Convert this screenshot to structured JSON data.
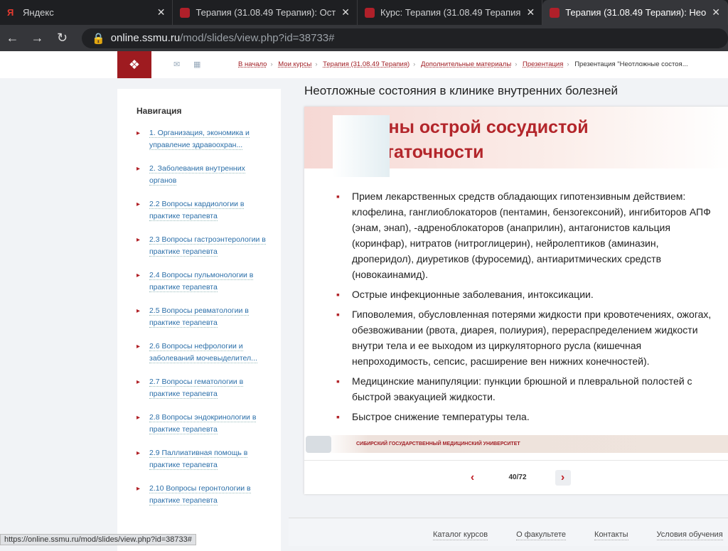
{
  "browser": {
    "tabs": [
      {
        "label": "Яндекс"
      },
      {
        "label": "Терапия (31.08.49 Терапия): Ост"
      },
      {
        "label": "Курс: Терапия (31.08.49 Терапия"
      },
      {
        "label": "Терапия (31.08.49 Терапия): Нео"
      }
    ],
    "url_host": "online.ssmu.ru",
    "url_path": "/mod/slides/view.php?id=38733#",
    "status_url": "https://online.ssmu.ru/mod/slides/view.php?id=38733#"
  },
  "breadcrumb": [
    "В начало",
    "Мои курсы",
    "Терапия (31.08.49 Терапия)",
    "Дополнительные материалы",
    "Презентация"
  ],
  "breadcrumb_current": "Презентация \"Неотложные состоя...",
  "sidebar": {
    "title": "Навигация",
    "items": [
      "1. Организация, экономика и управление здравоохран...",
      "2. Заболевания внутренних органов",
      "2.2 Вопросы кардиологии в практике терапевта",
      "2.3 Вопросы гастроэнтерологии в практике терапевта",
      "2.4 Вопросы пульмонологии в практике терапевта",
      "2.5 Вопросы ревматологии в практике терапевта",
      "2.6 Вопросы нефрологии и заболеваний мочевыделител...",
      "2.7 Вопросы гематологии в практике терапевта",
      "2.8 Вопросы эндокринологии в практике терапевта",
      "2.9 Паллиативная помощь в практике терапевта",
      "2.10 Вопросы геронтологии в практике терапевта"
    ]
  },
  "main": {
    "title": "Неотложные состояния в клинике внутренних болезней",
    "slide": {
      "title1": "Причины острой сосудистой",
      "title2": "недостаточности",
      "bullets": [
        [
          "Прием  лекарственных средств обладающих гипотензивным действием:",
          "клофелина, ганглиоблокаторов (пентамин, бензогексоний), ингибиторов АПФ",
          "(энам, энап), -адреноблокаторов (анаприлин), антагонистов кальция",
          "(коринфар), нитратов (нитроглицерин), нейролептиков (аминазин,",
          "дроперидол), диуретиков (фуросемид), антиаритмических средств",
          "(новокаинамид)."
        ],
        [
          "Острые инфекционные заболевания, интоксикации."
        ],
        [
          "Гиповолемия, обусловленная потерями жидкости при кровотечениях, ожогах,",
          "обезвоживании (рвота, диарея, полиурия), перераспределением жидкости",
          "внутри тела и ее выходом из циркуляторного русла (кишечная",
          "непроходимость, сепсис, расширение вен нижних конечностей)."
        ],
        [
          "Медицинские манипуляции: пункции брюшной и плевральной полостей с",
          "быстрой эвакуацией жидкости."
        ],
        [
          "Быстрое снижение температуры тела."
        ]
      ],
      "footer": "СИБИРСКИЙ ГОСУДАРСТВЕННЫЙ МЕДИЦИНСКИЙ УНИВЕРСИТЕТ"
    },
    "page": "40/72",
    "prev": "‹",
    "next": "›"
  },
  "footer_links": [
    "Каталог курсов",
    "О факультете",
    "Контакты",
    "Условия обучения"
  ]
}
